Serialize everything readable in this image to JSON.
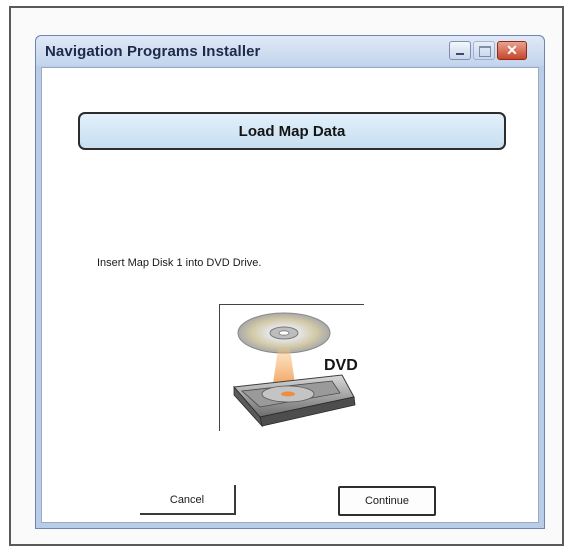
{
  "window": {
    "title": "Navigation Programs Installer",
    "close_glyph": "✕"
  },
  "header": {
    "title": "Load Map Data"
  },
  "instruction": {
    "text": "Insert Map Disk 1 into DVD Drive."
  },
  "illustration": {
    "label": "DVD",
    "icon": "dvd-drive-icon"
  },
  "buttons": {
    "cancel_label": "Cancel",
    "continue_label": "Continue"
  },
  "colors": {
    "title_bar": "#c2d4ec",
    "header_panel": "#c7def0",
    "close_button": "#c7452b",
    "disc_beam": "#f0822c"
  }
}
